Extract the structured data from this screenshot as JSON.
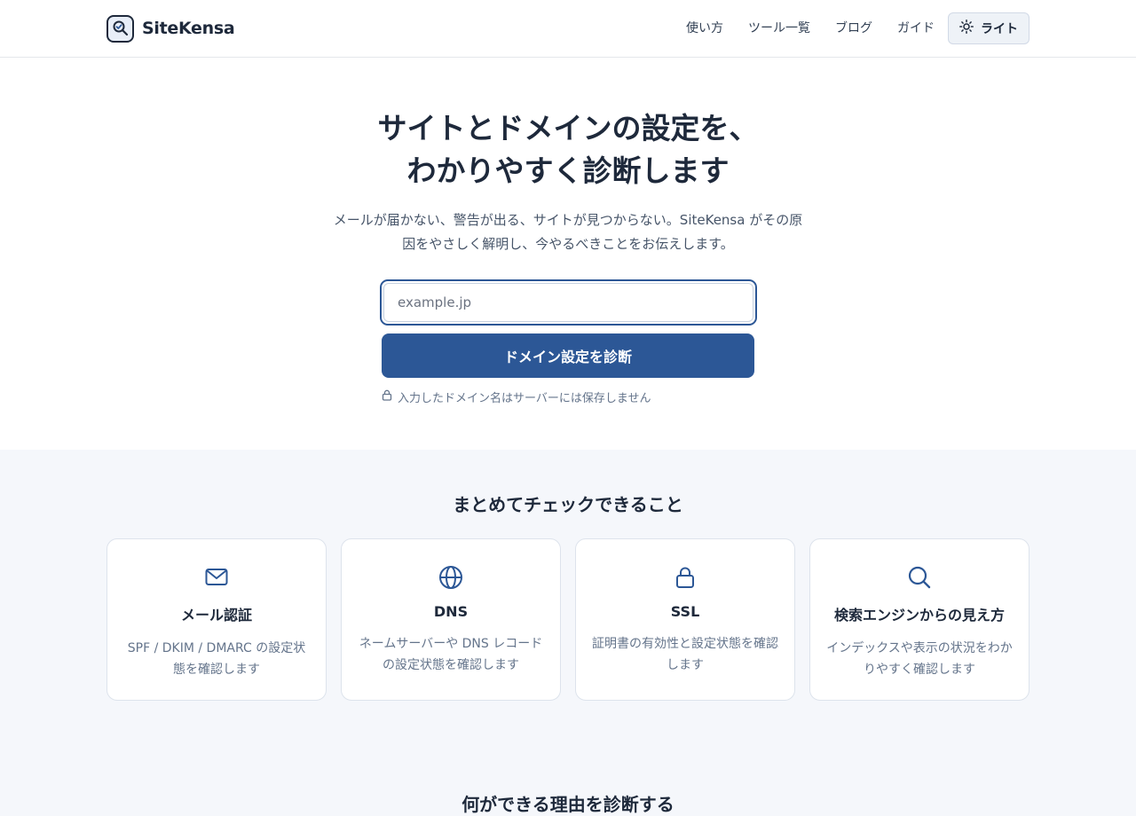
{
  "header": {
    "brand": "SiteKensa",
    "logo_icon": "magnifier-check-icon",
    "nav": [
      "使い方",
      "ツール一覧",
      "ブログ",
      "ガイド"
    ],
    "theme_toggle": {
      "label": "ライト",
      "icon": "sun-icon"
    }
  },
  "hero": {
    "title_line1": "サイトとドメインの設定を、",
    "title_line2": "わかりやすく診断します",
    "subtitle_line1": "メールが届かない、警告が出る、サイトが見つからない。SiteKensa がその原",
    "subtitle_line2": "因をやさしく解明し、今やるべきことをお伝えします。",
    "search": {
      "placeholder": "example.jp",
      "value": ""
    },
    "submit_label": "ドメイン設定を診断",
    "privacy_note": "入力したドメイン名はサーバーには保存しません",
    "privacy_icon": "lock-icon"
  },
  "features": {
    "title": "まとめてチェックできること",
    "cards": [
      {
        "icon": "mail-icon",
        "title": "メール認証",
        "desc": "SPF / DKIM / DMARC の設定状態を確認します"
      },
      {
        "icon": "globe-icon",
        "title": "DNS",
        "desc": "ネームサーバーや DNS レコードの設定状態を確認します"
      },
      {
        "icon": "lock-icon",
        "title": "SSL",
        "desc": "証明書の有効性と設定状態を確認します"
      },
      {
        "icon": "search-icon",
        "title": "検索エンジンからの見え方",
        "desc": "インデックスや表示の状況をわかりやすく確認します"
      }
    ]
  },
  "next_section_title": "何ができる理由を診断する",
  "colors": {
    "primary": "#2c5796",
    "text": "#1e293b",
    "muted": "#64748b",
    "section_bg": "#f5f7fb"
  }
}
